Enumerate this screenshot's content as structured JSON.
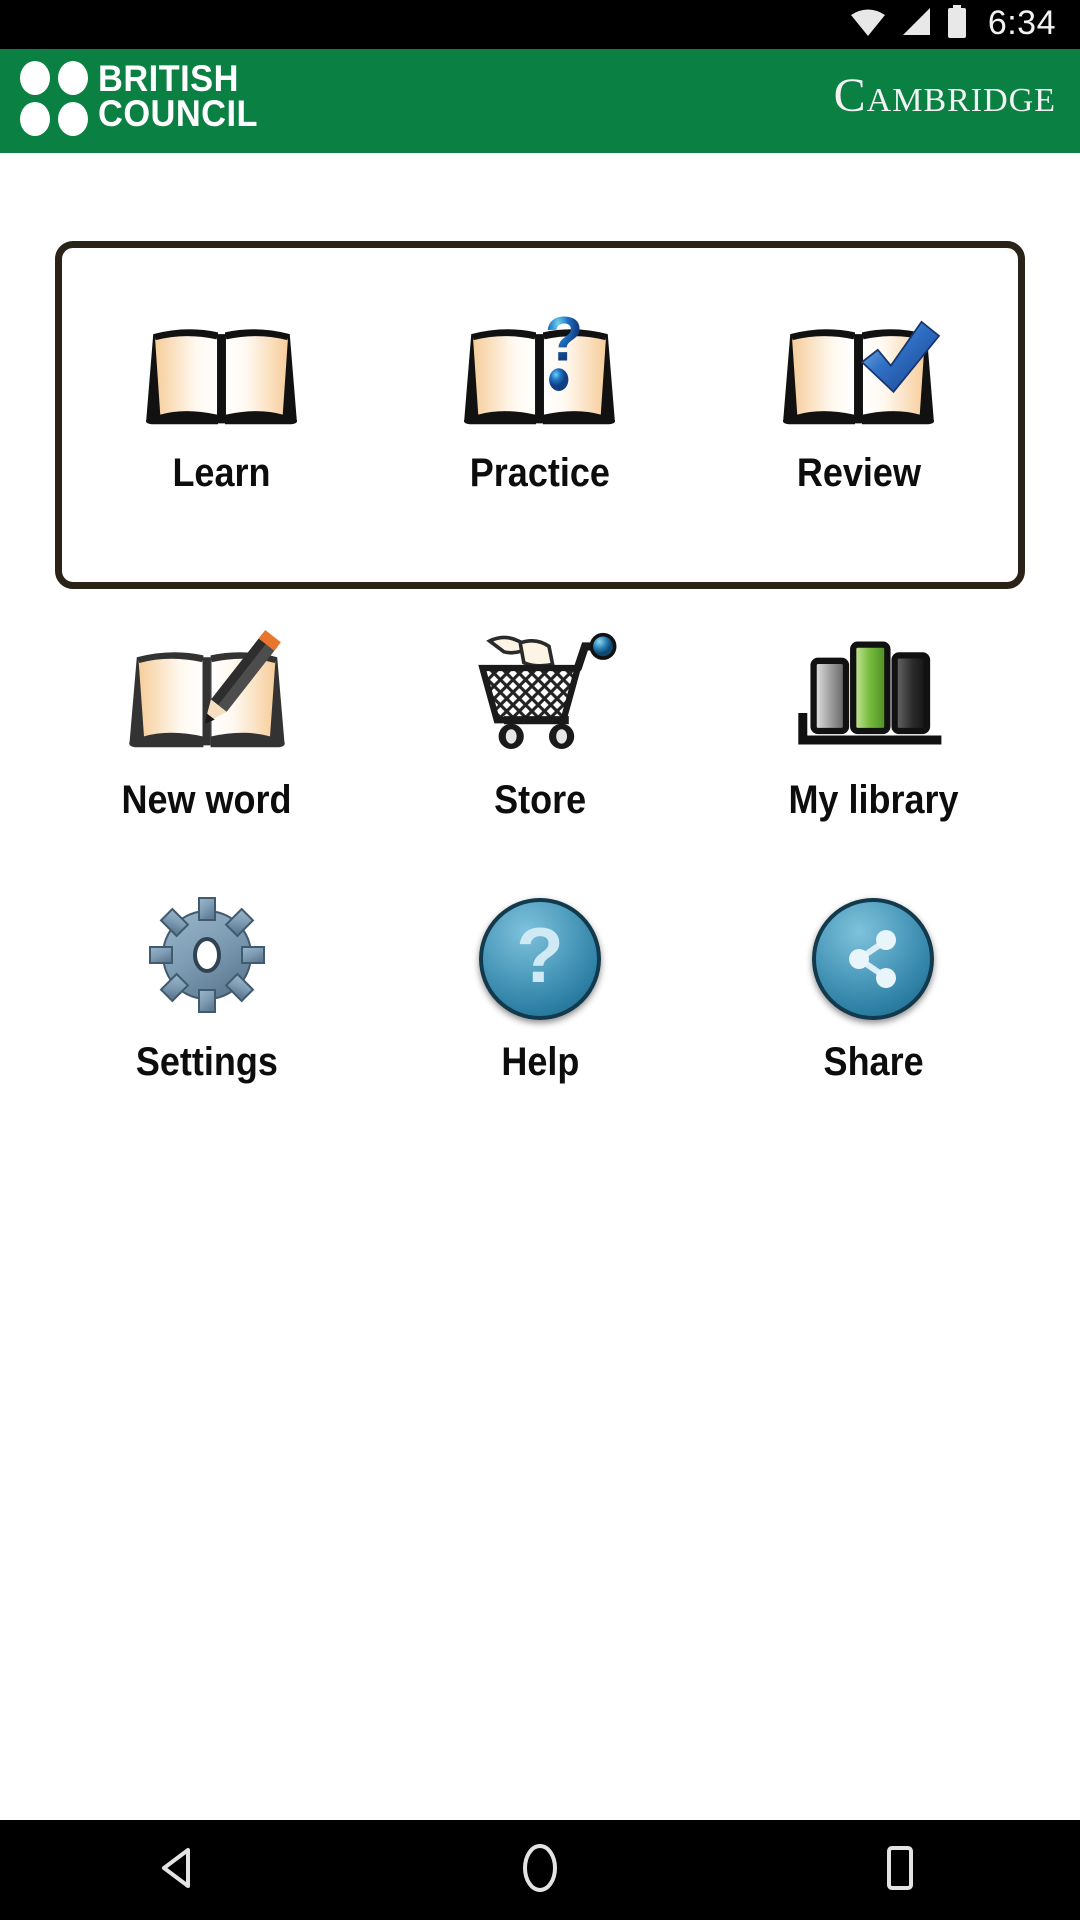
{
  "status_bar": {
    "time": "6:34",
    "icons": [
      "wifi-icon",
      "signal-icon",
      "battery-icon"
    ]
  },
  "header": {
    "brand_primary_line1": "BRITISH",
    "brand_primary_line2": "COUNCIL",
    "brand_secondary_cap": "C",
    "brand_secondary_rest": "AMBRIDGE",
    "background_color": "#0b8043",
    "logo_dots_icon": "british-council-dots-icon"
  },
  "learn_card": {
    "border_color": "#2b2218",
    "tiles": [
      {
        "label": "Learn",
        "icon": "open-book-icon"
      },
      {
        "label": "Practice",
        "icon": "open-book-question-mark-icon"
      },
      {
        "label": "Review",
        "icon": "open-book-check-mark-icon"
      }
    ]
  },
  "grid": {
    "rows": [
      [
        {
          "label": "New word",
          "icon": "book-pencil-icon"
        },
        {
          "label": "Store",
          "icon": "shopping-cart-icon"
        },
        {
          "label": "My library",
          "icon": "books-on-shelf-icon"
        }
      ],
      [
        {
          "label": "Settings",
          "icon": "gear-icon"
        },
        {
          "label": "Help",
          "icon": "question-mark-circle-icon"
        },
        {
          "label": "Share",
          "icon": "share-nodes-circle-icon"
        }
      ]
    ]
  },
  "nav_bar": {
    "buttons": [
      {
        "name": "back-button",
        "icon": "triangle-back-icon"
      },
      {
        "name": "home-button",
        "icon": "circle-home-icon"
      },
      {
        "name": "recents-button",
        "icon": "square-recents-icon"
      }
    ]
  },
  "colors": {
    "brand_green": "#0b8043",
    "card_border": "#2b2218",
    "orb_blue": "#2d7fa4",
    "book_page": "#fbe0bc",
    "library_green": "#7ac143"
  }
}
